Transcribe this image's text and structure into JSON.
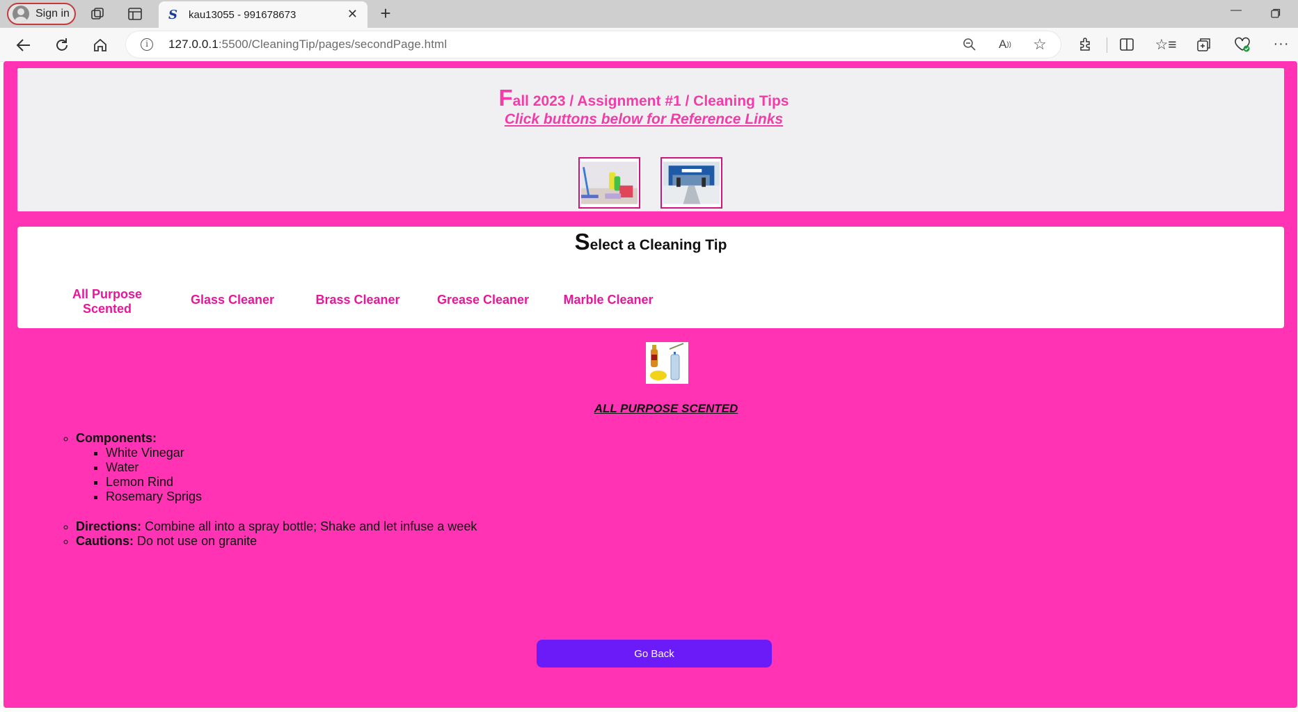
{
  "browser": {
    "sign_in_label": "Sign in",
    "tab_title": "kau13055 - 991678673",
    "favicon_letter": "S",
    "url_host": "127.0.0.1",
    "url_path": ":5500/CleaningTip/pages/secondPage.html",
    "icons": [
      "workspaces-icon",
      "vertical-tabs-icon",
      "close-tab-icon",
      "new-tab-icon",
      "minimize-icon",
      "restore-icon",
      "back-icon",
      "refresh-icon",
      "home-icon",
      "site-info-icon",
      "zoom-out-icon",
      "read-aloud-icon",
      "favorite-star-icon",
      "extensions-icon",
      "split-screen-icon",
      "favorites-icon",
      "collections-icon",
      "browser-essentials-icon",
      "more-icon"
    ]
  },
  "header": {
    "title_first_letter": "F",
    "title_rest": "all 2023 / Assignment #1 / Cleaning Tips",
    "subtitle": "Click buttons below for Reference Links",
    "ref_buttons": [
      "cleaning-supplies-image",
      "walmart-store-image"
    ]
  },
  "select": {
    "title_first_letter": "S",
    "title_rest": "elect a Cleaning Tip",
    "tips": [
      {
        "line1": "All Purpose",
        "line2": "Scented"
      },
      {
        "line1": "Glass Cleaner",
        "line2": ""
      },
      {
        "line1": "Brass Cleaner",
        "line2": ""
      },
      {
        "line1": "Grease Cleaner",
        "line2": ""
      },
      {
        "line1": "Marble Cleaner",
        "line2": ""
      }
    ]
  },
  "tip": {
    "heading": "ALL PURPOSE SCENTED",
    "components_label": "Components:",
    "components": [
      "White Vinegar",
      "Water",
      "Lemon Rind",
      "Rosemary Sprigs"
    ],
    "directions_label": "Directions:",
    "directions": "Combine all into a spray bottle; Shake and let infuse a week",
    "cautions_label": "Cautions:",
    "cautions": "Do not use on granite",
    "go_back_label": "Go Back"
  },
  "colors": {
    "page_bg": "#ff33b4",
    "accent_text": "#f23ca8",
    "button": "#6b1bf8"
  }
}
